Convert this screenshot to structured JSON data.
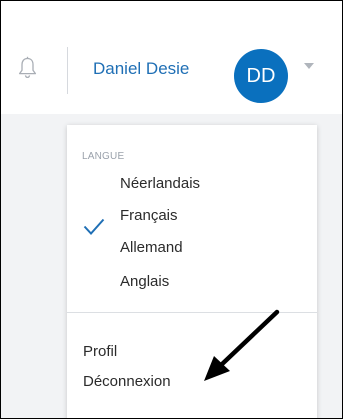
{
  "header": {
    "user_name": "Daniel Desie",
    "avatar_initials": "DD",
    "icons": {
      "notifications": "bell-icon",
      "menu_toggle": "caret-down-icon"
    }
  },
  "dropdown": {
    "language_section_label": "LANGUE",
    "languages": [
      {
        "label": "Néerlandais",
        "selected": false
      },
      {
        "label": "Français",
        "selected": true
      },
      {
        "label": "Allemand",
        "selected": false
      },
      {
        "label": "Anglais",
        "selected": false
      }
    ],
    "menu": [
      {
        "label": "Profil"
      },
      {
        "label": "Déconnexion"
      }
    ]
  },
  "annotation": {
    "icon": "arrow-icon",
    "color": "#000000"
  },
  "colors": {
    "accent": "#0a70be",
    "user_name": "#1f6fb5",
    "check": "#1f6fb5"
  }
}
